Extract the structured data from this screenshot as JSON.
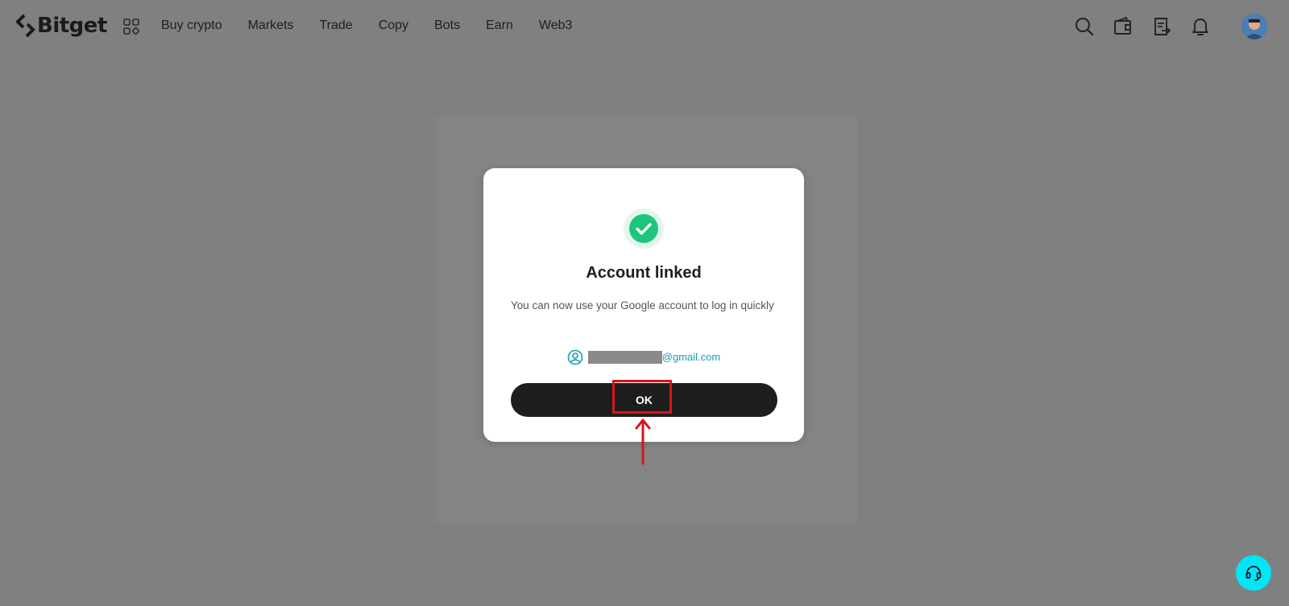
{
  "brand": {
    "name": "Bitget"
  },
  "nav": {
    "items": [
      {
        "label": "Buy crypto"
      },
      {
        "label": "Markets"
      },
      {
        "label": "Trade"
      },
      {
        "label": "Copy"
      },
      {
        "label": "Bots"
      },
      {
        "label": "Earn"
      },
      {
        "label": "Web3"
      }
    ]
  },
  "toolbar_icons": [
    "search-icon",
    "wallet-icon",
    "orders-icon",
    "bell-icon"
  ],
  "dialog": {
    "title": "Account linked",
    "description": "You can now use your Google account to log in quickly",
    "account_domain": "@gmail.com",
    "ok_label": "OK"
  },
  "colors": {
    "overlay": "#808080",
    "success_green": "#1ec67d",
    "accent_teal": "#1a9db5",
    "button_dark": "#1e1e1e",
    "annotation_red": "#d9141a",
    "support_cyan": "#00e6f6"
  }
}
